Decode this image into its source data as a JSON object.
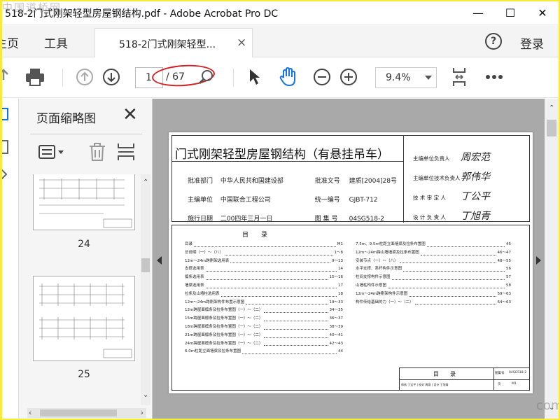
{
  "window": {
    "title": "518-2门式刚架轻型房屋钢结构.pdf - Adobe Acrobat Pro DC",
    "watermark": "中国道桥网",
    "minimize": "—",
    "maximize": "☐",
    "close": "✕"
  },
  "nav": {
    "home": "主页",
    "tools": "工具",
    "tab_label": "518-2门式刚架轻型...",
    "tab_close": "×",
    "help": "?",
    "login": "登录"
  },
  "toolbar": {
    "page_current": "1",
    "page_total": "/ 67",
    "zoom": "9.4%"
  },
  "panel": {
    "title": "页面缩略图",
    "close": "✕",
    "thumbnails": [
      {
        "number": "24"
      },
      {
        "number": "25"
      }
    ]
  },
  "document": {
    "title": "门式刚架轻型房屋钢结构（有悬挂吊车）",
    "rows": [
      {
        "label1": "批准部门",
        "value1": "中华人民共和国建设部",
        "label2": "批准文号",
        "value2": "建质[2004]28号"
      },
      {
        "label1": "主编单位",
        "value1": "中国联合工程公司",
        "label2": "统一编号",
        "value2": "GJBT-712"
      },
      {
        "label1": "施行日期",
        "value1": "二00四年三月一日",
        "label2": "图 集 号",
        "value2": "04SG518-2"
      }
    ],
    "signers": [
      {
        "role": "主编单位负责人",
        "sign": "周宏范"
      },
      {
        "role": "主编单位技术负责人",
        "sign": "郭伟华"
      },
      {
        "role": "技 术 审 定 人",
        "sign": "丁公平"
      },
      {
        "role": "设 计 负 责 人",
        "sign": "丁旭青"
      }
    ],
    "toc_heading": "目　　录",
    "toc_left": [
      {
        "t": "目录",
        "p": "M1"
      },
      {
        "t": "总说明（一）～（八）",
        "p": "1～8"
      },
      {
        "t": "12m～24m跨刚架选用表",
        "p": "9～13"
      },
      {
        "t": "支撑选用表",
        "p": "14"
      },
      {
        "t": "檩条选用表",
        "p": "15～16"
      },
      {
        "t": "墙梁选用表",
        "p": "17"
      },
      {
        "t": "拉条及山墙柱选用表",
        "p": "18"
      },
      {
        "t": "12m～24m跨刚架构件布置示意图",
        "p": "19～33"
      },
      {
        "t": "12m跨屋面檩条及拉条布置图（一）～（二）",
        "p": "34～35"
      },
      {
        "t": "15m跨屋面檩条及拉条布置图（一）～（二）",
        "p": "36～37"
      },
      {
        "t": "18m跨屋面檩条及拉条布置图（一）～（二）",
        "p": "38～39"
      },
      {
        "t": "21m跨屋面檩条及拉条布置图（一）～（二）",
        "p": "40～41"
      },
      {
        "t": "24m跨屋面檩条及拉条布置图（一）～（二）",
        "p": "42～43"
      },
      {
        "t": "6.0m柱距立面墙梁及拉条布置图",
        "p": "44"
      }
    ],
    "toc_right": [
      {
        "t": "7.5m、9.5m柱距立面墙梁及拉条布置图",
        "p": "45"
      },
      {
        "t": "12m～24m跨山墙墙梁及拉条布置图",
        "p": "46～47"
      },
      {
        "t": "安装节点（一）～（八）",
        "p": "48～55"
      },
      {
        "t": "水平支撑、系杆构件示意图",
        "p": "56"
      },
      {
        "t": "柱间支撑构件示意图",
        "p": "57"
      },
      {
        "t": "山墙柱构件示意图",
        "p": "58"
      },
      {
        "t": "12m～24m跨刚架构件示意图",
        "p": "59～63"
      },
      {
        "t": "构件传给基础的力（一）～（二）",
        "p": "64～63"
      }
    ],
    "footer_title": "目　　录",
    "footer_label": "图集号",
    "footer_code": "04SG518-2",
    "footer_page_label": "页",
    "footer_page": "M1",
    "footer_row": "审核 丁宝平 | 校对 周焕 | 设计 丁旭青"
  },
  "corner_watermark": "com"
}
